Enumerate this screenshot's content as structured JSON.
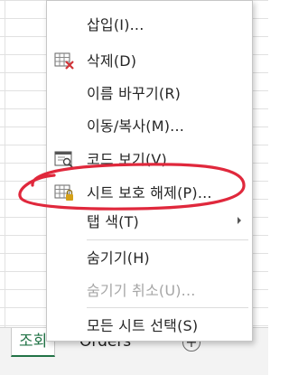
{
  "sheet_tabs": {
    "active": "조회",
    "other": "Orders",
    "add_symbol": "+"
  },
  "context_menu": {
    "items": [
      {
        "label": "삽입(I)...",
        "icon": "none",
        "enabled": true
      },
      {
        "label": "삭제(D)",
        "icon": "delete-sheet-icon",
        "enabled": true
      },
      {
        "label": "이름 바꾸기(R)",
        "icon": "none",
        "enabled": true
      },
      {
        "label": "이동/복사(M)...",
        "icon": "none",
        "enabled": true
      },
      {
        "label": "코드 보기(V)",
        "icon": "view-code-icon",
        "enabled": true
      },
      {
        "label": "시트 보호 해제(P)...",
        "icon": "unprotect-sheet-icon",
        "enabled": true
      },
      {
        "label": "탭 색(T)",
        "icon": "none",
        "enabled": true,
        "submenu": true
      },
      {
        "label": "숨기기(H)",
        "icon": "none",
        "enabled": true
      },
      {
        "label": "숨기기 취소(U)...",
        "icon": "none",
        "enabled": false
      },
      {
        "label": "모든 시트 선택(S)",
        "icon": "none",
        "enabled": true
      }
    ]
  },
  "colors": {
    "annotation_ring": "#e0283c",
    "tab_active": "#217346",
    "icon_red": "#d13438",
    "icon_lock": "#d4a017"
  }
}
